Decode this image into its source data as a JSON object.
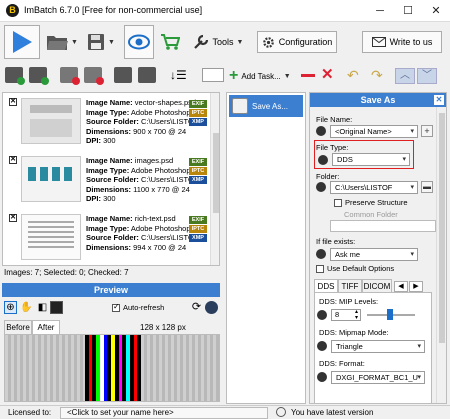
{
  "window": {
    "title": "ImBatch 6.7.0 [Free for non-commercial use]",
    "app_badge": "B",
    "minimize": "─",
    "maximize": "☐",
    "close": "✕"
  },
  "toolbar": {
    "tools_label": "Tools",
    "configuration_label": "Configuration",
    "write_label": "Write to us"
  },
  "images": [
    {
      "name_label": "Image Name:",
      "name": "vector-shapes.psd",
      "type_label": "Image Type:",
      "type": "Adobe Photoshop",
      "folder_label": "Source Folder:",
      "folder": "C:\\Users\\LISTOFF",
      "dim_label": "Dimensions:",
      "dims": "900 x 700 @ 24",
      "dpi_label": "DPI:",
      "dpi": "300",
      "badges": [
        "EXIF",
        "IPTC",
        "XMP"
      ]
    },
    {
      "name_label": "Image Name:",
      "name": "images.psd",
      "type_label": "Image Type:",
      "type": "Adobe Photoshop",
      "folder_label": "Source Folder:",
      "folder": "C:\\Users\\LISTOFF",
      "dim_label": "Dimensions:",
      "dims": "1100 x 770 @ 24",
      "dpi_label": "DPI:",
      "dpi": "300",
      "badges": [
        "EXIF",
        "IPTC",
        "XMP"
      ]
    },
    {
      "name_label": "Image Name:",
      "name": "rich-text.psd",
      "type_label": "Image Type:",
      "type": "Adobe Photoshop",
      "folder_label": "Source Folder:",
      "folder": "C:\\Users\\LISTOFF",
      "dim_label": "Dimensions:",
      "dims": "994 x 700 @ 24",
      "badges": [
        "EXIF",
        "IPTC",
        "XMP"
      ]
    }
  ],
  "list_status": "Images: 7; Selected: 0; Checked: 7",
  "preview": {
    "title": "Preview",
    "auto_refresh": "Auto-refresh",
    "tab_before": "Before",
    "tab_after": "After",
    "size": "128 x 128 px",
    "stripes": [
      "#000000",
      "#ff0000",
      "#000000",
      "#00ff00",
      "#ffffff",
      "#0000ff",
      "#000000",
      "#ffff00",
      "#000000",
      "#ff00ff",
      "#000000",
      "#00ffff",
      "#000000",
      "#ff0000",
      "#000000"
    ]
  },
  "tasks": {
    "add_task": "Add Task...",
    "items": [
      {
        "label": "Save As..."
      }
    ]
  },
  "saveas": {
    "title": "Save As",
    "file_name_label": "File Name:",
    "file_name_value": "<Original Name>",
    "file_type_label": "File Type:",
    "file_type_value": "DDS",
    "folder_label": "Folder:",
    "folder_value": "C:\\Users\\LISTOF",
    "preserve_structure": "Preserve Structure",
    "common_folder": "Common Folder",
    "if_exists_label": "If file exists:",
    "if_exists_value": "Ask me",
    "use_default_options": "Use Default Options",
    "tabs": [
      "DDS",
      "TIFF",
      "DICOM"
    ],
    "mip_levels_label": "DDS: MIP Levels:",
    "mip_levels_value": "8",
    "mipmap_mode_label": "DDS: Mipmap Mode:",
    "mipmap_mode_value": "Triangle",
    "format_label": "DDS: Format:",
    "format_value": "DXGI_FORMAT_BC1_U"
  },
  "statusbar": {
    "licensed_label": "Licensed to:",
    "licensed_value": "<Click to set your name here>",
    "version_status": "You have latest version"
  },
  "colors": {
    "accent": "#3c7fd1",
    "highlight_box": "#e02020"
  }
}
